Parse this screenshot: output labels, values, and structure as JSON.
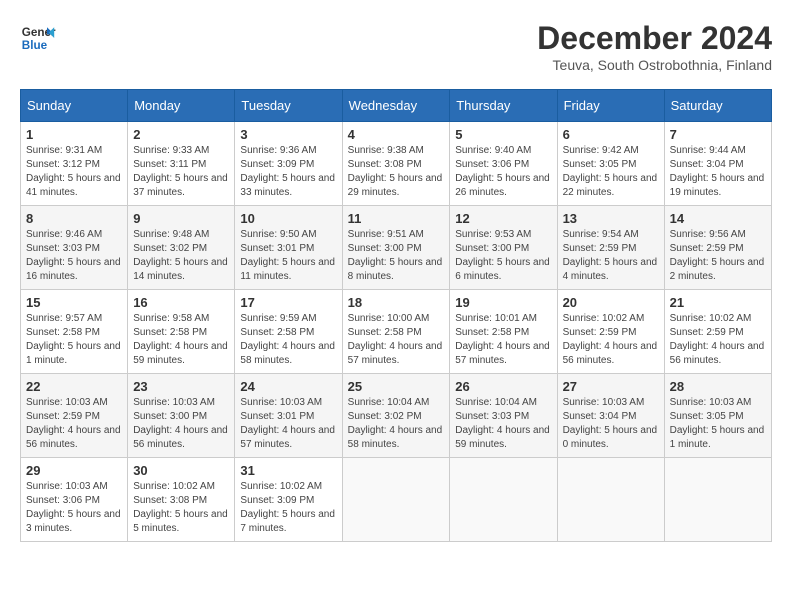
{
  "header": {
    "logo_line1": "General",
    "logo_line2": "Blue",
    "month_title": "December 2024",
    "location": "Teuva, South Ostrobothnia, Finland"
  },
  "weekdays": [
    "Sunday",
    "Monday",
    "Tuesday",
    "Wednesday",
    "Thursday",
    "Friday",
    "Saturday"
  ],
  "weeks": [
    [
      {
        "day": 1,
        "sunrise": "9:31 AM",
        "sunset": "3:12 PM",
        "daylight": "5 hours and 41 minutes."
      },
      {
        "day": 2,
        "sunrise": "9:33 AM",
        "sunset": "3:11 PM",
        "daylight": "5 hours and 37 minutes."
      },
      {
        "day": 3,
        "sunrise": "9:36 AM",
        "sunset": "3:09 PM",
        "daylight": "5 hours and 33 minutes."
      },
      {
        "day": 4,
        "sunrise": "9:38 AM",
        "sunset": "3:08 PM",
        "daylight": "5 hours and 29 minutes."
      },
      {
        "day": 5,
        "sunrise": "9:40 AM",
        "sunset": "3:06 PM",
        "daylight": "5 hours and 26 minutes."
      },
      {
        "day": 6,
        "sunrise": "9:42 AM",
        "sunset": "3:05 PM",
        "daylight": "5 hours and 22 minutes."
      },
      {
        "day": 7,
        "sunrise": "9:44 AM",
        "sunset": "3:04 PM",
        "daylight": "5 hours and 19 minutes."
      }
    ],
    [
      {
        "day": 8,
        "sunrise": "9:46 AM",
        "sunset": "3:03 PM",
        "daylight": "5 hours and 16 minutes."
      },
      {
        "day": 9,
        "sunrise": "9:48 AM",
        "sunset": "3:02 PM",
        "daylight": "5 hours and 14 minutes."
      },
      {
        "day": 10,
        "sunrise": "9:50 AM",
        "sunset": "3:01 PM",
        "daylight": "5 hours and 11 minutes."
      },
      {
        "day": 11,
        "sunrise": "9:51 AM",
        "sunset": "3:00 PM",
        "daylight": "5 hours and 8 minutes."
      },
      {
        "day": 12,
        "sunrise": "9:53 AM",
        "sunset": "3:00 PM",
        "daylight": "5 hours and 6 minutes."
      },
      {
        "day": 13,
        "sunrise": "9:54 AM",
        "sunset": "2:59 PM",
        "daylight": "5 hours and 4 minutes."
      },
      {
        "day": 14,
        "sunrise": "9:56 AM",
        "sunset": "2:59 PM",
        "daylight": "5 hours and 2 minutes."
      }
    ],
    [
      {
        "day": 15,
        "sunrise": "9:57 AM",
        "sunset": "2:58 PM",
        "daylight": "5 hours and 1 minute."
      },
      {
        "day": 16,
        "sunrise": "9:58 AM",
        "sunset": "2:58 PM",
        "daylight": "4 hours and 59 minutes."
      },
      {
        "day": 17,
        "sunrise": "9:59 AM",
        "sunset": "2:58 PM",
        "daylight": "4 hours and 58 minutes."
      },
      {
        "day": 18,
        "sunrise": "10:00 AM",
        "sunset": "2:58 PM",
        "daylight": "4 hours and 57 minutes."
      },
      {
        "day": 19,
        "sunrise": "10:01 AM",
        "sunset": "2:58 PM",
        "daylight": "4 hours and 57 minutes."
      },
      {
        "day": 20,
        "sunrise": "10:02 AM",
        "sunset": "2:59 PM",
        "daylight": "4 hours and 56 minutes."
      },
      {
        "day": 21,
        "sunrise": "10:02 AM",
        "sunset": "2:59 PM",
        "daylight": "4 hours and 56 minutes."
      }
    ],
    [
      {
        "day": 22,
        "sunrise": "10:03 AM",
        "sunset": "2:59 PM",
        "daylight": "4 hours and 56 minutes."
      },
      {
        "day": 23,
        "sunrise": "10:03 AM",
        "sunset": "3:00 PM",
        "daylight": "4 hours and 56 minutes."
      },
      {
        "day": 24,
        "sunrise": "10:03 AM",
        "sunset": "3:01 PM",
        "daylight": "4 hours and 57 minutes."
      },
      {
        "day": 25,
        "sunrise": "10:04 AM",
        "sunset": "3:02 PM",
        "daylight": "4 hours and 58 minutes."
      },
      {
        "day": 26,
        "sunrise": "10:04 AM",
        "sunset": "3:03 PM",
        "daylight": "4 hours and 59 minutes."
      },
      {
        "day": 27,
        "sunrise": "10:03 AM",
        "sunset": "3:04 PM",
        "daylight": "5 hours and 0 minutes."
      },
      {
        "day": 28,
        "sunrise": "10:03 AM",
        "sunset": "3:05 PM",
        "daylight": "5 hours and 1 minute."
      }
    ],
    [
      {
        "day": 29,
        "sunrise": "10:03 AM",
        "sunset": "3:06 PM",
        "daylight": "5 hours and 3 minutes."
      },
      {
        "day": 30,
        "sunrise": "10:02 AM",
        "sunset": "3:08 PM",
        "daylight": "5 hours and 5 minutes."
      },
      {
        "day": 31,
        "sunrise": "10:02 AM",
        "sunset": "3:09 PM",
        "daylight": "5 hours and 7 minutes."
      },
      null,
      null,
      null,
      null
    ]
  ]
}
